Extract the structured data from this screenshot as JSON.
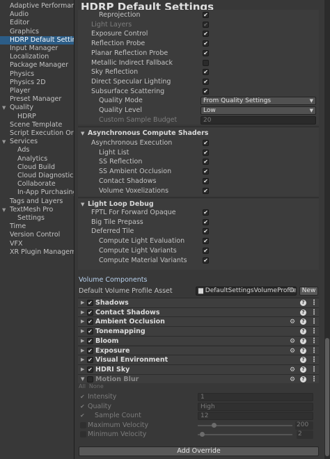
{
  "sidebar": {
    "items": [
      {
        "label": "Adaptive Performance",
        "indent": 0
      },
      {
        "label": "Audio",
        "indent": 0
      },
      {
        "label": "Editor",
        "indent": 0
      },
      {
        "label": "Graphics",
        "indent": 0
      },
      {
        "label": "HDRP Default Settings",
        "indent": 0,
        "selected": true
      },
      {
        "label": "Input Manager",
        "indent": 0
      },
      {
        "label": "Localization",
        "indent": 0
      },
      {
        "label": "Package Manager",
        "indent": 0
      },
      {
        "label": "Physics",
        "indent": 0
      },
      {
        "label": "Physics 2D",
        "indent": 0
      },
      {
        "label": "Player",
        "indent": 0
      },
      {
        "label": "Preset Manager",
        "indent": 0
      },
      {
        "label": "Quality",
        "indent": 0,
        "foldout": true
      },
      {
        "label": "HDRP",
        "indent": 1
      },
      {
        "label": "Scene Template",
        "indent": 0
      },
      {
        "label": "Script Execution Order",
        "indent": 0
      },
      {
        "label": "Services",
        "indent": 0,
        "foldout": true
      },
      {
        "label": "Ads",
        "indent": 1
      },
      {
        "label": "Analytics",
        "indent": 1
      },
      {
        "label": "Cloud Build",
        "indent": 1
      },
      {
        "label": "Cloud Diagnostics",
        "indent": 1
      },
      {
        "label": "Collaborate",
        "indent": 1
      },
      {
        "label": "In-App Purchasing",
        "indent": 1
      },
      {
        "label": "Tags and Layers",
        "indent": 0
      },
      {
        "label": "TextMesh Pro",
        "indent": 0,
        "foldout": true
      },
      {
        "label": "Settings",
        "indent": 1
      },
      {
        "label": "Time",
        "indent": 0
      },
      {
        "label": "Version Control",
        "indent": 0
      },
      {
        "label": "VFX",
        "indent": 0
      },
      {
        "label": "XR Plugin Management",
        "indent": 0
      }
    ]
  },
  "header": {
    "title": "HDRP Default Settings"
  },
  "lighting_rows": [
    {
      "label": "Reprojection",
      "checked": true,
      "indent": 2
    },
    {
      "label": "Light Layers",
      "checked": true,
      "indent": 1,
      "dim": true
    },
    {
      "label": "Exposure Control",
      "checked": true,
      "indent": 1
    },
    {
      "label": "Reflection Probe",
      "checked": true,
      "indent": 1
    },
    {
      "label": "Planar Reflection Probe",
      "checked": true,
      "indent": 1
    },
    {
      "label": "Metallic Indirect Fallback",
      "checked": false,
      "indent": 1
    },
    {
      "label": "Sky Reflection",
      "checked": true,
      "indent": 1
    },
    {
      "label": "Direct Specular Lighting",
      "checked": true,
      "indent": 1
    },
    {
      "label": "Subsurface Scattering",
      "checked": true,
      "indent": 1
    }
  ],
  "sss": {
    "quality_mode_label": "Quality Mode",
    "quality_mode_value": "From Quality Settings",
    "quality_level_label": "Quality Level",
    "quality_level_value": "Low",
    "custom_budget_label": "Custom Sample Budget",
    "custom_budget_value": "20"
  },
  "async_section": {
    "title": "Asynchronous Compute Shaders",
    "rows": [
      {
        "label": "Asynchronous Execution",
        "checked": true,
        "indent": 1
      },
      {
        "label": "Light List",
        "checked": true,
        "indent": 2
      },
      {
        "label": "SS Reflection",
        "checked": true,
        "indent": 2
      },
      {
        "label": "SS Ambient Occlusion",
        "checked": true,
        "indent": 2
      },
      {
        "label": "Contact Shadows",
        "checked": true,
        "indent": 2
      },
      {
        "label": "Volume Voxelizations",
        "checked": true,
        "indent": 2
      }
    ]
  },
  "lightloop_section": {
    "title": "Light Loop Debug",
    "rows": [
      {
        "label": "FPTL For Forward Opaque",
        "checked": true,
        "indent": 1
      },
      {
        "label": "Big Tile Prepass",
        "checked": true,
        "indent": 1
      },
      {
        "label": "Deferred Tile",
        "checked": true,
        "indent": 1
      },
      {
        "label": "Compute Light Evaluation",
        "checked": true,
        "indent": 2
      },
      {
        "label": "Compute Light Variants",
        "checked": true,
        "indent": 2
      },
      {
        "label": "Compute Material Variants",
        "checked": true,
        "indent": 2
      }
    ]
  },
  "volume": {
    "heading": "Volume Components",
    "profile_label": "Default Volume Profile Asset",
    "profile_value": "DefaultSettingsVolumeProfile",
    "new_button": "New",
    "components": [
      {
        "name": "Shadows",
        "gear": false
      },
      {
        "name": "Contact Shadows",
        "gear": false
      },
      {
        "name": "Ambient Occlusion",
        "gear": true
      },
      {
        "name": "Tonemapping",
        "gear": false
      },
      {
        "name": "Bloom",
        "gear": true
      },
      {
        "name": "Exposure",
        "gear": true
      },
      {
        "name": "Visual Environment",
        "gear": false
      },
      {
        "name": "HDRI Sky",
        "gear": true
      },
      {
        "name": "Motion Blur",
        "gear": true,
        "dim": true,
        "expanded": true
      }
    ],
    "all_label": "All",
    "none_label": "None",
    "motion_blur": {
      "intensity_label": "Intensity",
      "intensity_value": "1",
      "quality_label": "Quality",
      "quality_value": "High",
      "sample_count_label": "Sample Count",
      "sample_count_value": "12",
      "max_velocity_label": "Maximum Velocity",
      "max_velocity_value": "200",
      "max_velocity_fraction": 0.15,
      "min_velocity_label": "Minimum Velocity",
      "min_velocity_value": "2",
      "min_velocity_fraction": 0.02
    },
    "add_override": "Add Override"
  },
  "icons": {
    "check": "✔",
    "foldout_open": "▼",
    "foldout_closed": "▶",
    "gear": "⚙",
    "help": "?",
    "more": "⋮",
    "object_picker": "⊙",
    "asset": "▆"
  },
  "colors": {
    "selection": "#2c5d87",
    "background": "#383838",
    "volume_heading": "#b9d2ee"
  }
}
